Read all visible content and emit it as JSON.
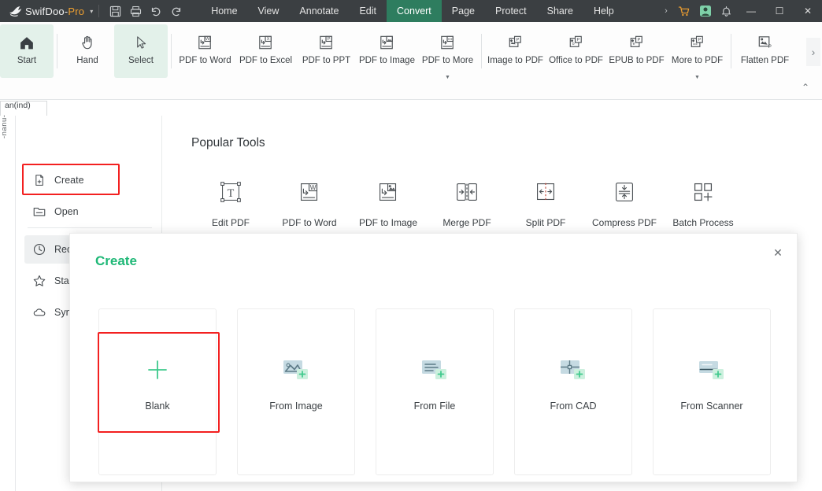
{
  "titlebar": {
    "logo_icon": "swifdoo-bird-logo",
    "brand_main": "SwifDoo",
    "brand_sep": "-",
    "brand_pro": "Pro",
    "brand_caret": "▾",
    "quick_actions": [
      {
        "name": "save-icon",
        "label": "Save"
      },
      {
        "name": "print-icon",
        "label": "Print"
      },
      {
        "name": "undo-icon",
        "label": "Undo"
      },
      {
        "name": "redo-icon",
        "label": "Redo"
      }
    ],
    "menus": [
      {
        "label": "Home",
        "active": false
      },
      {
        "label": "View",
        "active": false
      },
      {
        "label": "Annotate",
        "active": false
      },
      {
        "label": "Edit",
        "active": false
      },
      {
        "label": "Convert",
        "active": true
      },
      {
        "label": "Page",
        "active": false
      },
      {
        "label": "Protect",
        "active": false
      },
      {
        "label": "Share",
        "active": false
      },
      {
        "label": "Help",
        "active": false
      }
    ],
    "overflow_caret": "›",
    "cart_icon": "shopping-cart-icon",
    "account_icon": "user-account-icon",
    "bell_icon": "notification-bell-icon",
    "minimize": "—",
    "maximize": "☐",
    "close": "✕",
    "colors": {
      "bar_bg": "#3b3f42",
      "active_tab": "#2e7d5f",
      "pro_accent": "#f0a030"
    }
  },
  "ribbon": {
    "items": [
      {
        "label": "Start",
        "icon": "home-icon",
        "highlight": true,
        "caret": false
      },
      {
        "label": "Hand",
        "icon": "hand-icon",
        "highlight": false,
        "caret": false
      },
      {
        "label": "Select",
        "icon": "cursor-select-icon",
        "highlight": true,
        "caret": false
      },
      {
        "label": "PDF to Word",
        "icon": "pdf-to-word-icon",
        "highlight": false,
        "caret": false
      },
      {
        "label": "PDF to Excel",
        "icon": "pdf-to-excel-icon",
        "highlight": false,
        "caret": false
      },
      {
        "label": "PDF to PPT",
        "icon": "pdf-to-ppt-icon",
        "highlight": false,
        "caret": false
      },
      {
        "label": "PDF to Image",
        "icon": "pdf-to-image-icon",
        "highlight": false,
        "caret": false
      },
      {
        "label": "PDF to More",
        "icon": "pdf-to-more-icon",
        "highlight": false,
        "caret": true
      },
      {
        "label": "Image to PDF",
        "icon": "image-to-pdf-icon",
        "highlight": false,
        "caret": false
      },
      {
        "label": "Office to PDF",
        "icon": "office-to-pdf-icon",
        "highlight": false,
        "caret": false
      },
      {
        "label": "EPUB to PDF",
        "icon": "epub-to-pdf-icon",
        "highlight": false,
        "caret": false
      },
      {
        "label": "More to PDF",
        "icon": "more-to-pdf-icon",
        "highlight": false,
        "caret": true
      },
      {
        "label": "Flatten PDF",
        "icon": "flatten-pdf-icon",
        "highlight": false,
        "caret": false
      }
    ],
    "overflow_arrow": "›",
    "collapse_chevron": "⌃"
  },
  "doctab": {
    "clipped_label": "an(ind)",
    "vertical_label": "-nanu-"
  },
  "sidebar": {
    "items": [
      {
        "label": "Create",
        "icon": "new-document-icon",
        "selected": false
      },
      {
        "label": "Open",
        "icon": "open-folder-icon",
        "selected": false
      },
      {
        "label": "Recent",
        "icon": "clock-recent-icon",
        "selected": true
      },
      {
        "label": "Starred",
        "icon": "star-icon",
        "selected": false
      },
      {
        "label": "Sync",
        "icon": "cloud-icon",
        "selected": false
      }
    ]
  },
  "main": {
    "section_title": "Popular Tools",
    "tools": [
      {
        "label": "Edit PDF",
        "icon": "edit-text-box-icon"
      },
      {
        "label": "PDF to Word",
        "icon": "pdf-to-word-icon"
      },
      {
        "label": "PDF to Image",
        "icon": "pdf-to-image-icon"
      },
      {
        "label": "Merge PDF",
        "icon": "merge-pdf-icon"
      },
      {
        "label": "Split PDF",
        "icon": "split-pdf-icon"
      },
      {
        "label": "Compress PDF",
        "icon": "compress-pdf-icon"
      },
      {
        "label": "Batch Process",
        "icon": "batch-process-icon"
      }
    ]
  },
  "dialog": {
    "title": "Create",
    "close_glyph": "✕",
    "cards": [
      {
        "label": "Blank",
        "icon": "plus-icon",
        "highlighted": true
      },
      {
        "label": "From Image",
        "icon": "from-image-icon",
        "highlighted": false
      },
      {
        "label": "From File",
        "icon": "from-file-icon",
        "highlighted": false
      },
      {
        "label": "From CAD",
        "icon": "from-cad-icon",
        "highlighted": false
      },
      {
        "label": "From Scanner",
        "icon": "from-scanner-icon",
        "highlighted": false
      }
    ]
  },
  "annotations": {
    "highlight_color": "#f32020",
    "boxes": [
      {
        "name": "create-sidebar-highlight"
      },
      {
        "name": "blank-card-highlight"
      }
    ]
  }
}
